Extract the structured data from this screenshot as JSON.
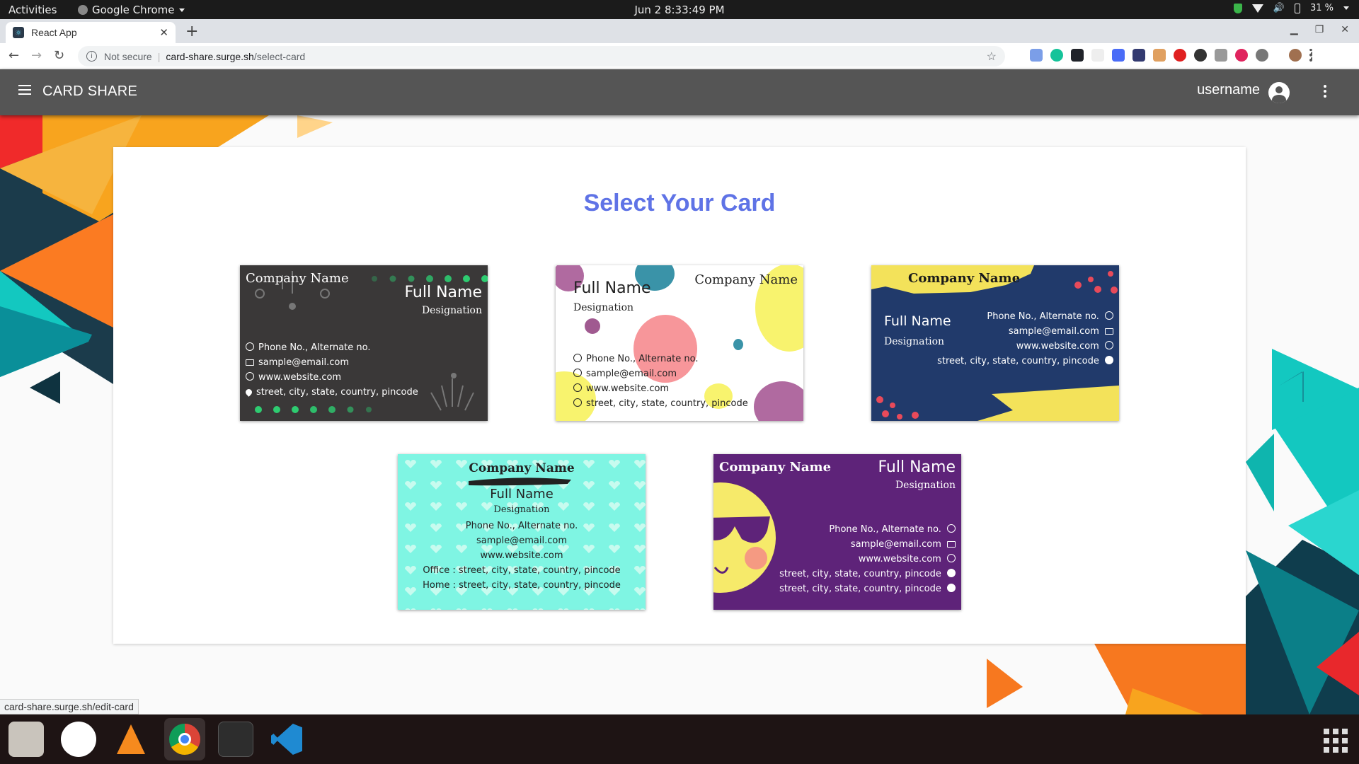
{
  "system": {
    "activities": "Activities",
    "app_name": "Google Chrome",
    "clock": "Jun 2   8:33:49 PM",
    "battery": "31 %"
  },
  "browser": {
    "tab_title": "React App",
    "security": "Not secure",
    "url_host": "card-share.surge.sh",
    "url_path": "/select-card",
    "status_url": "card-share.surge.sh/edit-card"
  },
  "appbar": {
    "title": "CARD SHARE",
    "username": "username"
  },
  "main": {
    "heading": "Select Your Card"
  },
  "cards": [
    {
      "company": "Company Name",
      "name": "Full Name",
      "designation": "Designation",
      "phone": "Phone No., Alternate no.",
      "email": "sample@email.com",
      "website": "www.website.com",
      "address": "street, city, state, country, pincode"
    },
    {
      "company": "Company Name",
      "name": "Full Name",
      "designation": "Designation",
      "phone": "Phone No., Alternate no.",
      "email": "sample@email.com",
      "website": "www.website.com",
      "address": "street, city, state, country, pincode"
    },
    {
      "company": "Company Name",
      "name": "Full Name",
      "designation": "Designation",
      "phone": "Phone No., Alternate no.",
      "email": "sample@email.com",
      "website": "www.website.com",
      "address": "street, city, state, country, pincode"
    },
    {
      "company": "Company Name",
      "name": "Full Name",
      "designation": "Designation",
      "phone": "Phone No., Alternate no.",
      "email": "sample@email.com",
      "website": "www.website.com",
      "office": "Office : street, city, state, country, pincode",
      "home": "Home : street, city, state, country, pincode"
    },
    {
      "company": "Company Name",
      "name": "Full Name",
      "designation": "Designation",
      "phone": "Phone No., Alternate no.",
      "email": "sample@email.com",
      "website": "www.website.com",
      "address1": "street, city, state, country, pincode",
      "address2": "street, city, state, country, pincode"
    }
  ],
  "colors": {
    "heading": "#5f73e6",
    "appbar": "#555555",
    "card1_bg": "#3a3838",
    "card3_bg": "#213a6b",
    "card4_bg": "#7ff5e3",
    "card5_bg": "#5e2379",
    "accent_orange": "#f7781f",
    "accent_teal": "#13c8c0"
  }
}
